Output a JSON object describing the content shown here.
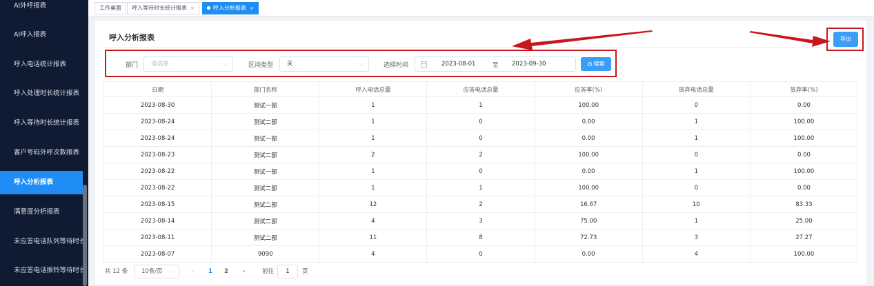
{
  "sidebar": {
    "items": [
      {
        "label": "AI外呼报表"
      },
      {
        "label": "AI呼入报表"
      },
      {
        "label": "呼入电话统计报表"
      },
      {
        "label": "呼入处理时长统计报表"
      },
      {
        "label": "呼入等待时长统计报表"
      },
      {
        "label": "客户号码外呼次数报表"
      },
      {
        "label": "呼入分析报表"
      },
      {
        "label": "满意度分析报表"
      },
      {
        "label": "未应答电话队列等待时长"
      },
      {
        "label": "未应答电话振铃等待时长"
      }
    ],
    "active_index": 6
  },
  "tabs": [
    {
      "label": "工作桌面"
    },
    {
      "label": "呼入等待时长统计报表",
      "close": "×"
    },
    {
      "label": "呼入分析报表",
      "close": "×"
    }
  ],
  "page": {
    "title": "呼入分析报表",
    "export_label": "导出"
  },
  "filters": {
    "dept_label": "部门",
    "dept_placeholder": "请选择",
    "range_label": "区间类型",
    "range_value": "天",
    "time_label": "选择时间",
    "date_start": "2023-08-01",
    "date_sep": "至",
    "date_end": "2023-09-30",
    "search_label": "搜索"
  },
  "table": {
    "headers": [
      "日期",
      "部门名称",
      "呼入电话总量",
      "应答电话总量",
      "应答率(%)",
      "放弃电话总量",
      "放弃率(%)"
    ],
    "rows": [
      [
        "2023-08-30",
        "测试一部",
        "1",
        "1",
        "100.00",
        "0",
        "0.00"
      ],
      [
        "2023-08-24",
        "测试二部",
        "1",
        "0",
        "0.00",
        "1",
        "100.00"
      ],
      [
        "2023-08-24",
        "测试一部",
        "1",
        "0",
        "0.00",
        "1",
        "100.00"
      ],
      [
        "2023-08-23",
        "测试二部",
        "2",
        "2",
        "100.00",
        "0",
        "0.00"
      ],
      [
        "2023-08-22",
        "测试一部",
        "1",
        "0",
        "0.00",
        "1",
        "100.00"
      ],
      [
        "2023-08-22",
        "测试二部",
        "1",
        "1",
        "100.00",
        "0",
        "0.00"
      ],
      [
        "2023-08-15",
        "测试二部",
        "12",
        "2",
        "16.67",
        "10",
        "83.33"
      ],
      [
        "2023-08-14",
        "测试二部",
        "4",
        "3",
        "75.00",
        "1",
        "25.00"
      ],
      [
        "2023-08-11",
        "测试二部",
        "11",
        "8",
        "72.73",
        "3",
        "27.27"
      ],
      [
        "2023-08-07",
        "9090",
        "4",
        "0",
        "0.00",
        "4",
        "100.00"
      ]
    ]
  },
  "pagination": {
    "total_text": "共 12 条",
    "page_size": "10条/页",
    "prev": "‹",
    "pages": [
      "1",
      "2"
    ],
    "current": "1",
    "next": "›",
    "goto_label": "前往",
    "goto_value": "1",
    "page_suffix": "页"
  },
  "colors": {
    "sidebar_bg": "#0f1b33",
    "accent": "#1e8df5",
    "highlight_red": "#c8161d"
  }
}
